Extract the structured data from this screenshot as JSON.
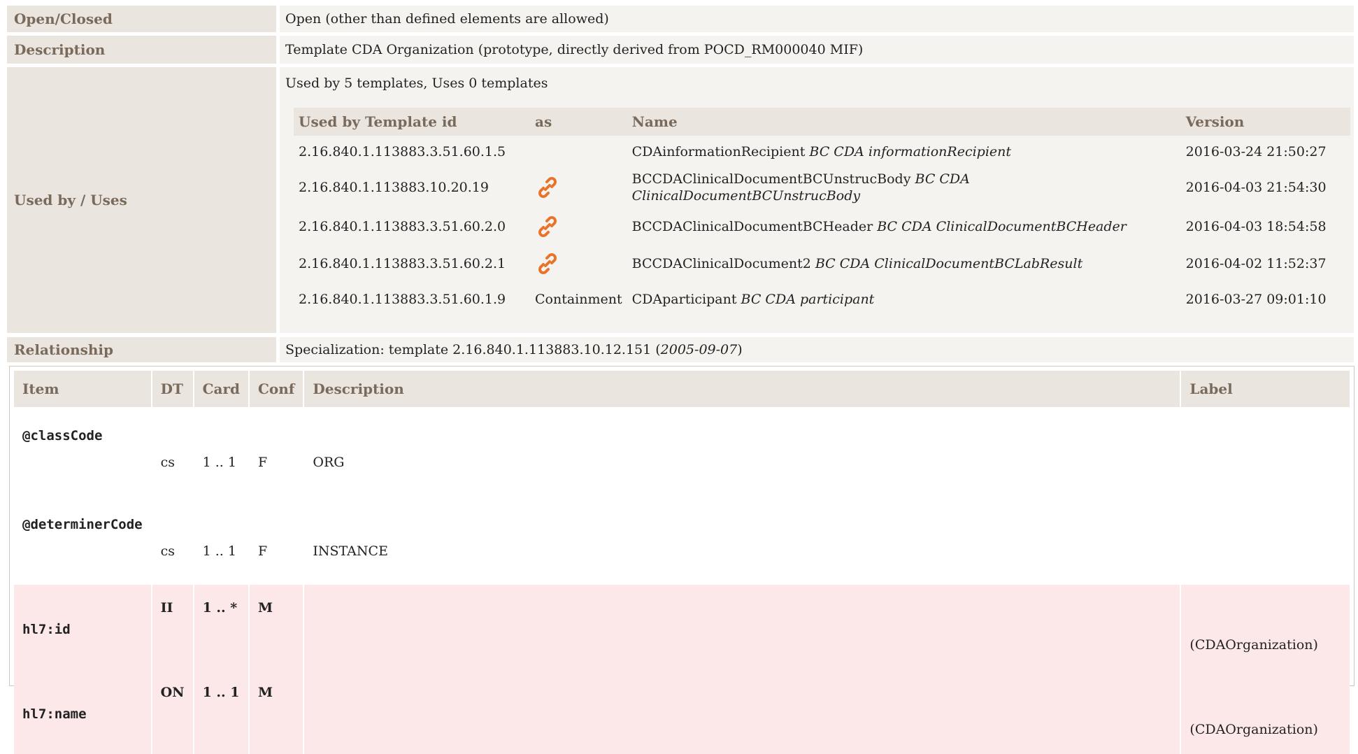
{
  "properties": {
    "open_closed": {
      "label": "Open/Closed",
      "value": "Open (other than defined elements are allowed)"
    },
    "description": {
      "label": "Description",
      "value": "Template CDA Organization (prototype, directly derived from POCD_RM000040 MIF)"
    },
    "used_by": {
      "label": "Used by / Uses",
      "summary": "Used by 5 templates, Uses 0 templates"
    },
    "relationship": {
      "label": "Relationship",
      "prefix": "Specialization: template 2.16.840.1.113883.10.12.151 (",
      "date": "2005-09-07",
      "suffix": ")"
    }
  },
  "used_by_table": {
    "headers": {
      "id": "Used by Template id",
      "as": "as",
      "name": "Name",
      "version": "Version"
    },
    "rows": [
      {
        "id": "2.16.840.1.113883.3.51.60.1.5",
        "as": "",
        "as_icon": "",
        "name": "CDAinformationRecipient",
        "name_italic": "BC CDA informationRecipient",
        "version": "2016-03-24 21:50:27"
      },
      {
        "id": "2.16.840.1.113883.10.20.19",
        "as": "",
        "as_icon": "link-icon",
        "name": "BCCDAClinicalDocumentBCUnstrucBody",
        "name_italic": "BC CDA ClinicalDocumentBCUnstrucBody",
        "version": "2016-04-03 21:54:30"
      },
      {
        "id": "2.16.840.1.113883.3.51.60.2.0",
        "as": "",
        "as_icon": "link-icon",
        "name": "BCCDAClinicalDocumentBCHeader",
        "name_italic": "BC CDA ClinicalDocumentBCHeader",
        "version": "2016-04-03 18:54:58"
      },
      {
        "id": "2.16.840.1.113883.3.51.60.2.1",
        "as": "",
        "as_icon": "link-icon",
        "name": "BCCDAClinicalDocument2",
        "name_italic": "BC CDA ClinicalDocumentBCLabResult",
        "version": "2016-04-02 11:52:37"
      },
      {
        "id": "2.16.840.1.113883.3.51.60.1.9",
        "as": "Containment",
        "as_icon": "",
        "name": "CDAparticipant",
        "name_italic": "BC CDA participant",
        "version": "2016-03-27 09:01:10"
      }
    ]
  },
  "items_table": {
    "headers": {
      "item": "Item",
      "dt": "DT",
      "card": "Card",
      "conf": "Conf",
      "description": "Description",
      "label": "Label"
    },
    "rows": [
      {
        "item": "@classCode",
        "dt": "cs",
        "card": "1 .. 1",
        "conf": "F",
        "description": "ORG",
        "label": ""
      },
      {
        "item": "@determinerCode",
        "dt": "cs",
        "card": "1 .. 1",
        "conf": "F",
        "description": "INSTANCE",
        "label": ""
      },
      {
        "item": "hl7:id",
        "dt": "II",
        "card": "1 .. *",
        "conf": "M",
        "description": "",
        "label": "(CDAOrganization)"
      },
      {
        "item": "hl7:name",
        "dt": "ON",
        "card": "1 .. 1",
        "conf": "M",
        "description": "",
        "label": "(CDAOrganization)"
      }
    ]
  },
  "colors": {
    "header_bg": "#eae5de",
    "header_text": "#7a6a5b",
    "value_bg": "#f5f3ef",
    "required_row_bg": "#fce8e8",
    "link_icon": "#e8742a"
  }
}
